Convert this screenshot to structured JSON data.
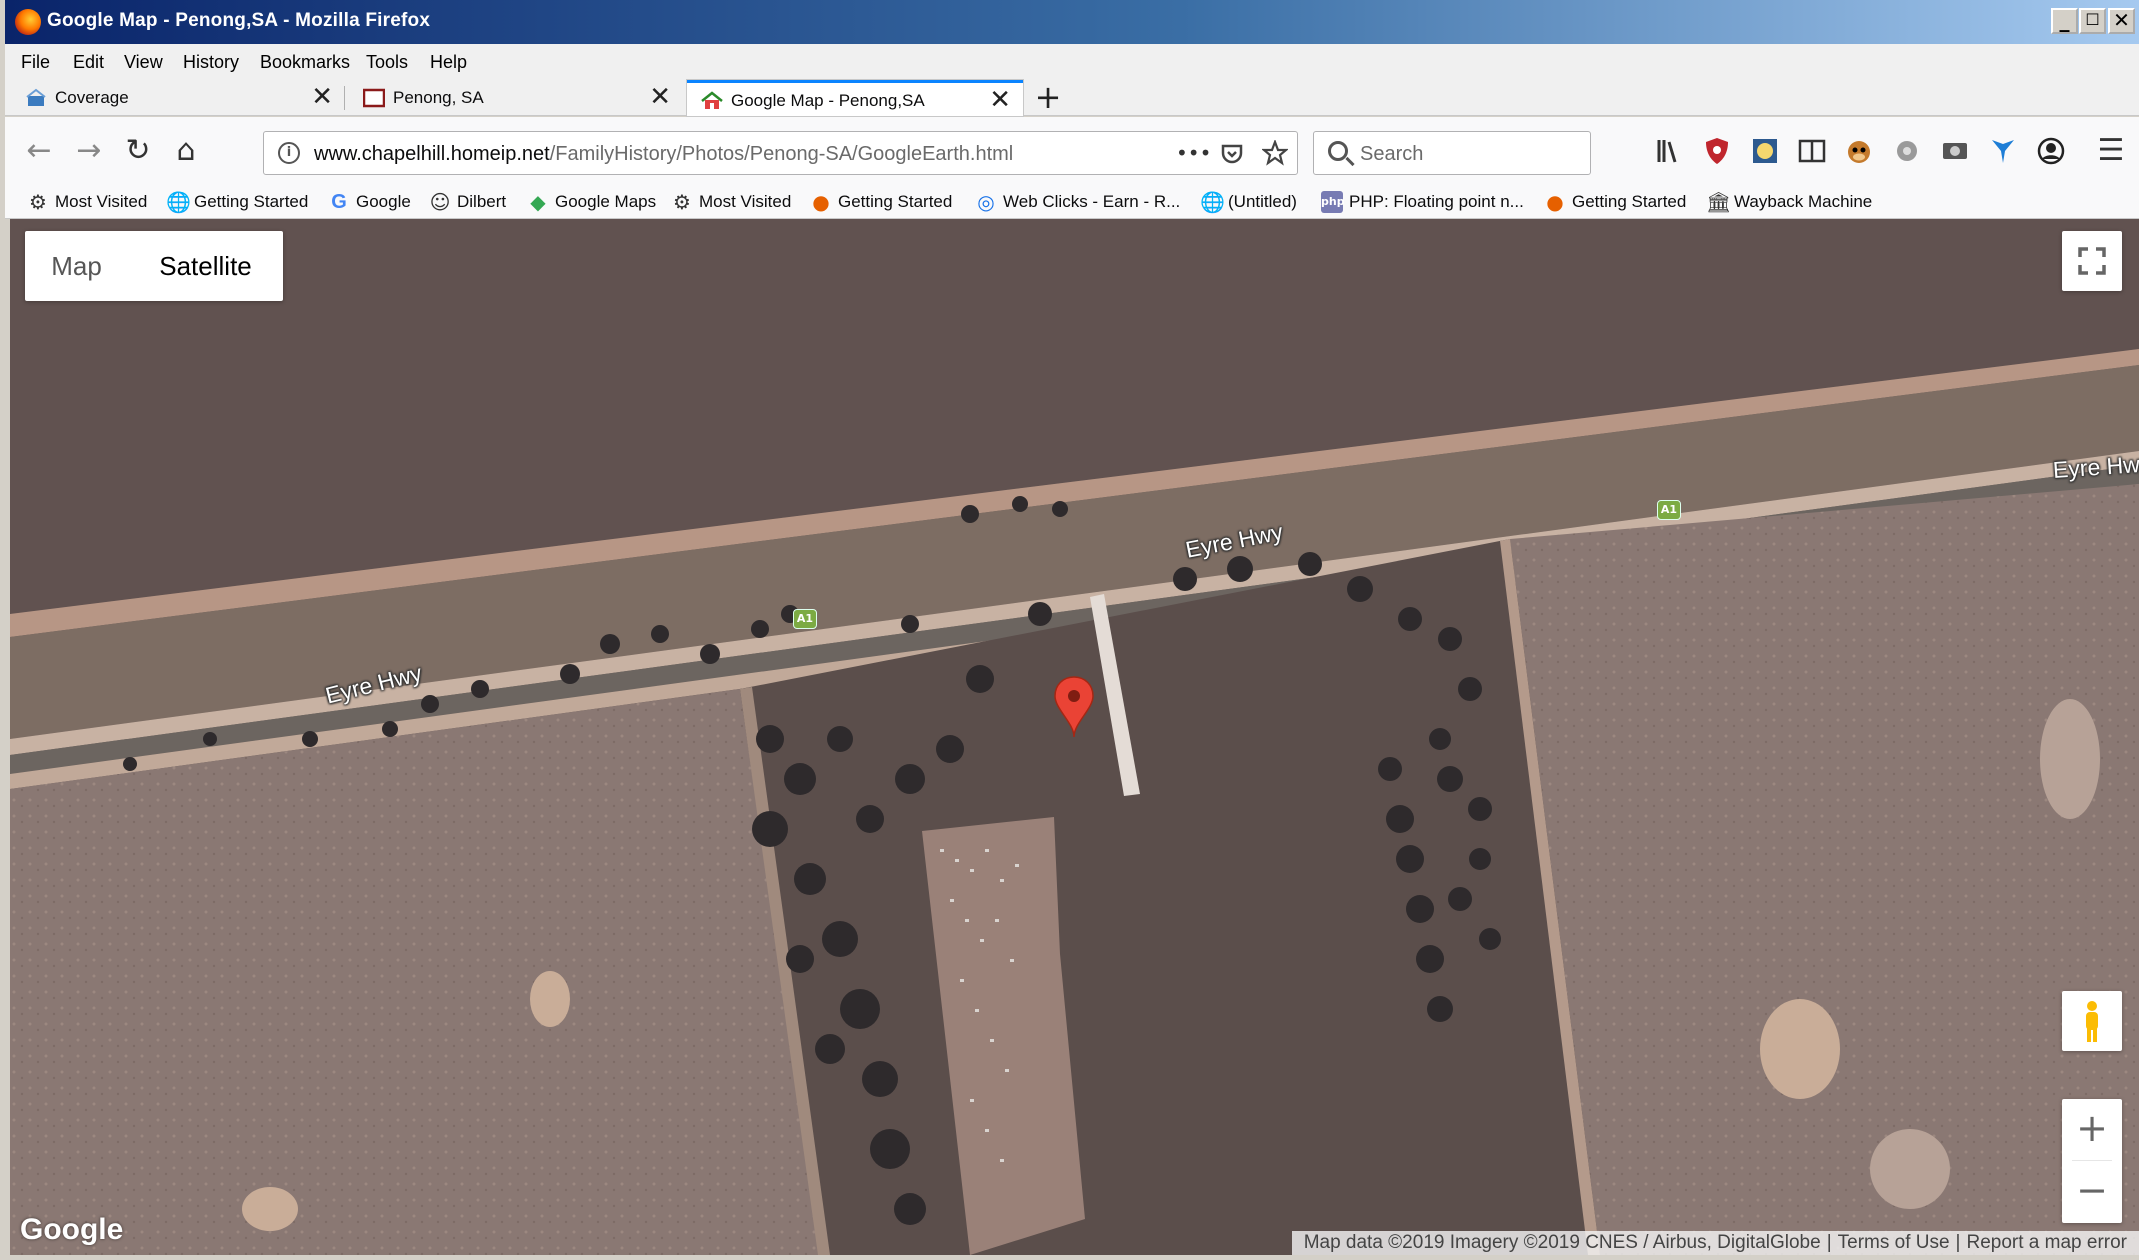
{
  "window": {
    "title": "Google Map - Penong,SA - Mozilla Firefox",
    "controls": [
      "_",
      "☐",
      "✕"
    ]
  },
  "menu": [
    "File",
    "Edit",
    "View",
    "History",
    "Bookmarks",
    "Tools",
    "Help"
  ],
  "tabs": [
    {
      "label": "Coverage",
      "close": "✕"
    },
    {
      "label": "Penong, SA",
      "close": "✕"
    },
    {
      "label": "Google Map - Penong,SA",
      "close": "✕",
      "active": true
    }
  ],
  "new_tab": "+",
  "nav": {
    "back": "←",
    "forward": "→",
    "reload": "↻",
    "home": "⌂",
    "url_domain": "www.chapelhill.homeip.net",
    "url_path": "/FamilyHistory/Photos/Penong-SA/GoogleEarth.html",
    "page_actions": "•••",
    "search_placeholder": "Search",
    "menu": "☰"
  },
  "bookmarks": [
    {
      "label": "Most Visited",
      "icon": "gear-icon"
    },
    {
      "label": "Getting Started",
      "icon": "globe-icon"
    },
    {
      "label": "Google",
      "icon": "google-icon"
    },
    {
      "label": "Dilbert",
      "icon": "dilbert-icon"
    },
    {
      "label": "Google Maps",
      "icon": "maps-icon"
    },
    {
      "label": "Most Visited",
      "icon": "gear-icon"
    },
    {
      "label": "Getting Started",
      "icon": "firefox-icon"
    },
    {
      "label": "Web Clicks - Earn - R...",
      "icon": "webclicks-icon"
    },
    {
      "label": "(Untitled)",
      "icon": "globe-icon"
    },
    {
      "label": "PHP: Floating point n...",
      "icon": "php-icon"
    },
    {
      "label": "Getting Started",
      "icon": "firefox-icon"
    },
    {
      "label": "Wayback Machine",
      "icon": "wayback-icon"
    }
  ],
  "map": {
    "type_map": "Map",
    "type_satellite": "Satellite",
    "road_label": "Eyre Hwy",
    "route_shield": "A1",
    "zoom_in": "+",
    "zoom_out": "−",
    "logo": "Google",
    "attribution": "Map data ©2019 Imagery ©2019 CNES / Airbus, DigitalGlobe",
    "terms": "Terms of Use",
    "report": "Report a map error",
    "marker_color": "#ea4335"
  }
}
